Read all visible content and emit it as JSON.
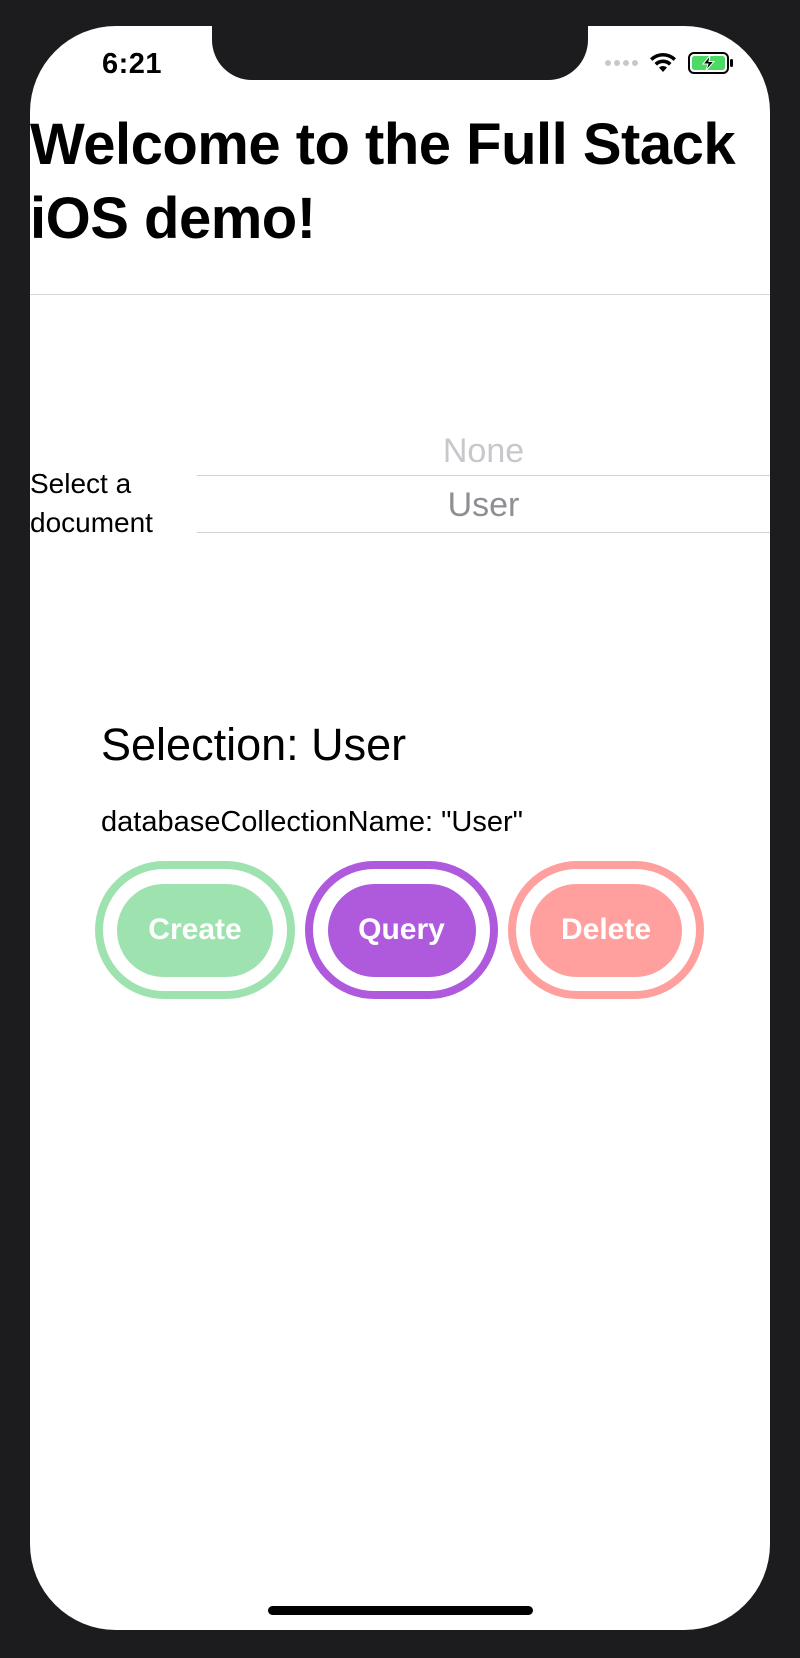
{
  "status_bar": {
    "time": "6:21"
  },
  "header": {
    "title": "Welcome to the Full Stack iOS demo!"
  },
  "document_picker": {
    "label": "Select a document",
    "options": [
      "None",
      "User"
    ],
    "selected": "User"
  },
  "selection": {
    "text": "Selection: User",
    "collection_text": "databaseCollectionName: \"User\""
  },
  "actions": {
    "create_label": "Create",
    "query_label": "Query",
    "delete_label": "Delete"
  },
  "colors": {
    "create": "#9ee2b0",
    "query": "#af59dd",
    "delete": "#ffa09e"
  },
  "icons": [
    "cellular-signal-icon",
    "wifi-icon",
    "battery-charging-icon"
  ]
}
